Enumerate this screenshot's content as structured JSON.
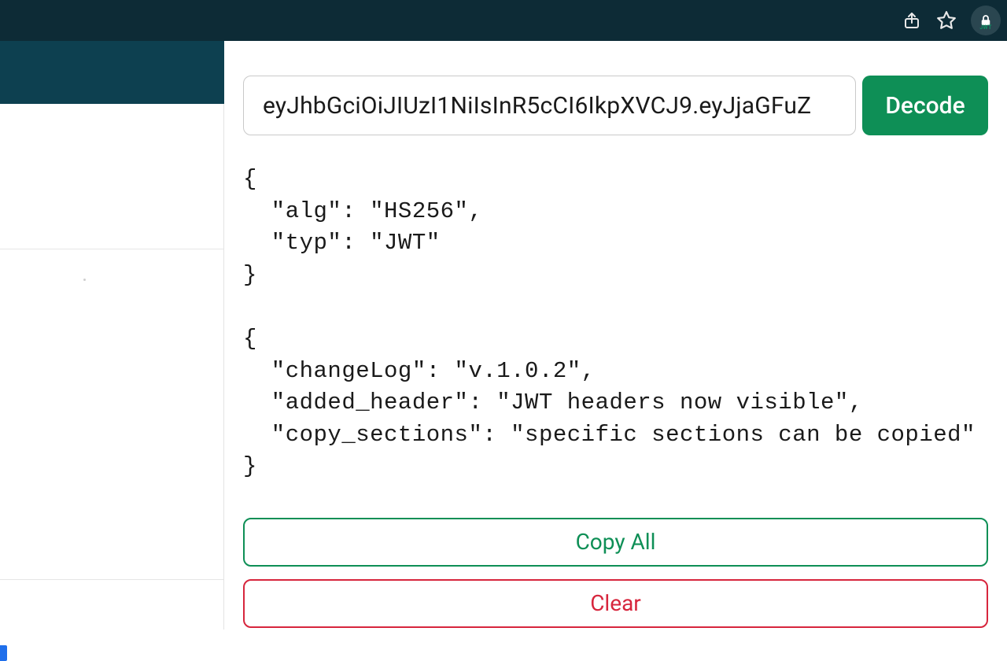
{
  "colors": {
    "chrome_bg": "#0d2b36",
    "secondary_bg": "#0d4050",
    "accent_green": "#0e8f56",
    "accent_red": "#d7263d"
  },
  "extension_badge": {
    "label": "JWT"
  },
  "input": {
    "value": "eyJhbGciOiJIUzI1NiIsInR5cCI6IkpXVCJ9.eyJjaGFuZ"
  },
  "buttons": {
    "decode": "Decode",
    "copy_all": "Copy All",
    "clear": "Clear"
  },
  "decoded": {
    "header": {
      "alg": "HS256",
      "typ": "JWT"
    },
    "payload": {
      "changeLog": "v.1.0.2",
      "added_header": "JWT headers now visible",
      "copy_sections": "specific sections can be copied"
    }
  }
}
